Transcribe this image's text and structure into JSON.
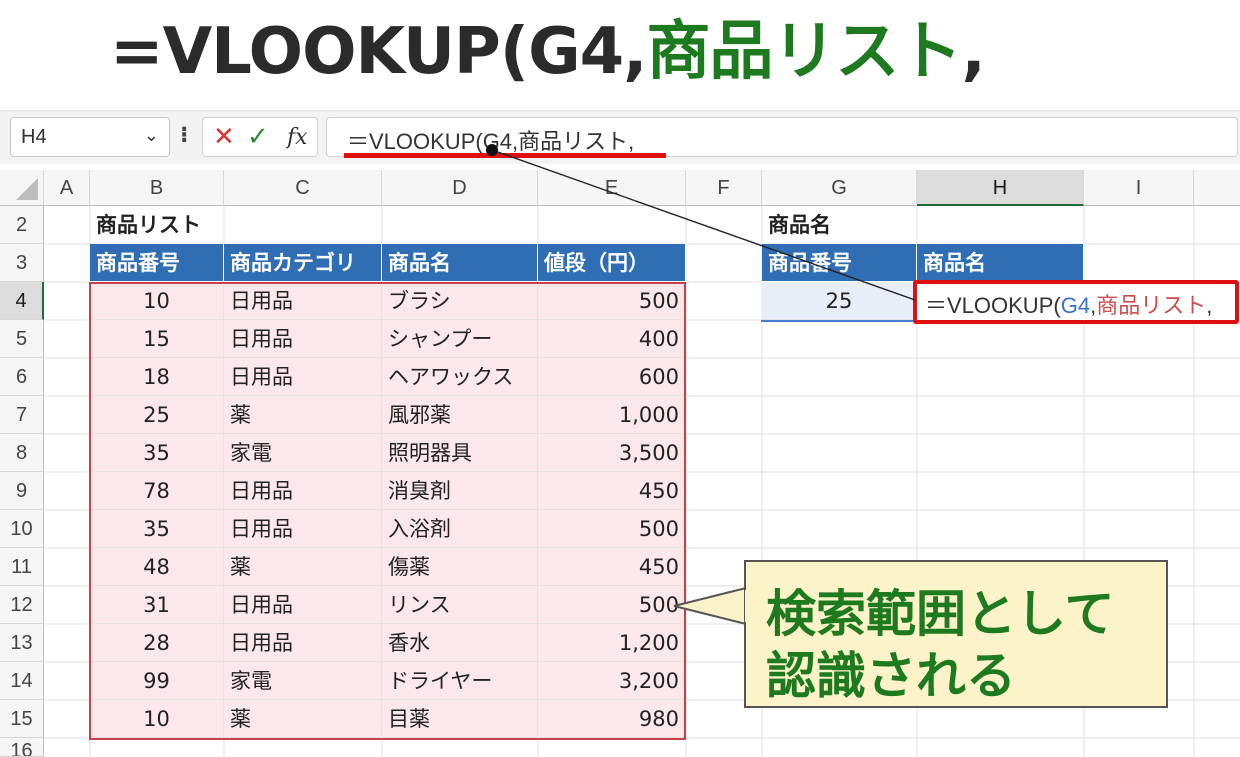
{
  "header": {
    "part1": "=VLOOKUP(G4,",
    "part2": "商品リスト",
    "part3": ","
  },
  "formula_bar": {
    "name_box": "H4",
    "cancel_icon": "✕",
    "enter_icon": "✓",
    "fx_label": "fx",
    "formula": "＝VLOOKUP(G4,商品リスト,"
  },
  "columns": [
    "A",
    "B",
    "C",
    "D",
    "E",
    "F",
    "G",
    "H",
    "I"
  ],
  "rows": [
    "2",
    "3",
    "4",
    "5",
    "6",
    "7",
    "8",
    "9",
    "10",
    "11",
    "12",
    "13",
    "14",
    "15",
    "16"
  ],
  "product_list": {
    "title": "商品リスト",
    "headers": [
      "商品番号",
      "商品カテゴリ",
      "商品名",
      "値段（円）"
    ],
    "rows": [
      [
        "10",
        "日用品",
        "ブラシ",
        "500"
      ],
      [
        "15",
        "日用品",
        "シャンプー",
        "400"
      ],
      [
        "18",
        "日用品",
        "ヘアワックス",
        "600"
      ],
      [
        "25",
        "薬",
        "風邪薬",
        "1,000"
      ],
      [
        "35",
        "家電",
        "照明器具",
        "3,500"
      ],
      [
        "78",
        "日用品",
        "消臭剤",
        "450"
      ],
      [
        "35",
        "日用品",
        "入浴剤",
        "500"
      ],
      [
        "48",
        "薬",
        "傷薬",
        "450"
      ],
      [
        "31",
        "日用品",
        "リンス",
        "500"
      ],
      [
        "28",
        "日用品",
        "香水",
        "1,200"
      ],
      [
        "99",
        "家電",
        "ドライヤー",
        "3,200"
      ],
      [
        "10",
        "薬",
        "目薬",
        "980"
      ]
    ]
  },
  "lookup": {
    "title": "商品名",
    "headers": [
      "商品番号",
      "商品名"
    ],
    "g4_value": "25",
    "h4_prefix": "＝VLOOKUP(",
    "h4_ref": "G4",
    "h4_comma1": ",",
    "h4_range": "商品リスト",
    "h4_comma2": ","
  },
  "callout": {
    "line1": "検索範囲として",
    "line2": "認識される"
  },
  "colors": {
    "header_blue": "#2f6db5",
    "range_pink": "#fce8ea",
    "highlight_red": "#e01010",
    "callout_green": "#1e7a1e",
    "callout_bg": "#fdf3c8"
  }
}
